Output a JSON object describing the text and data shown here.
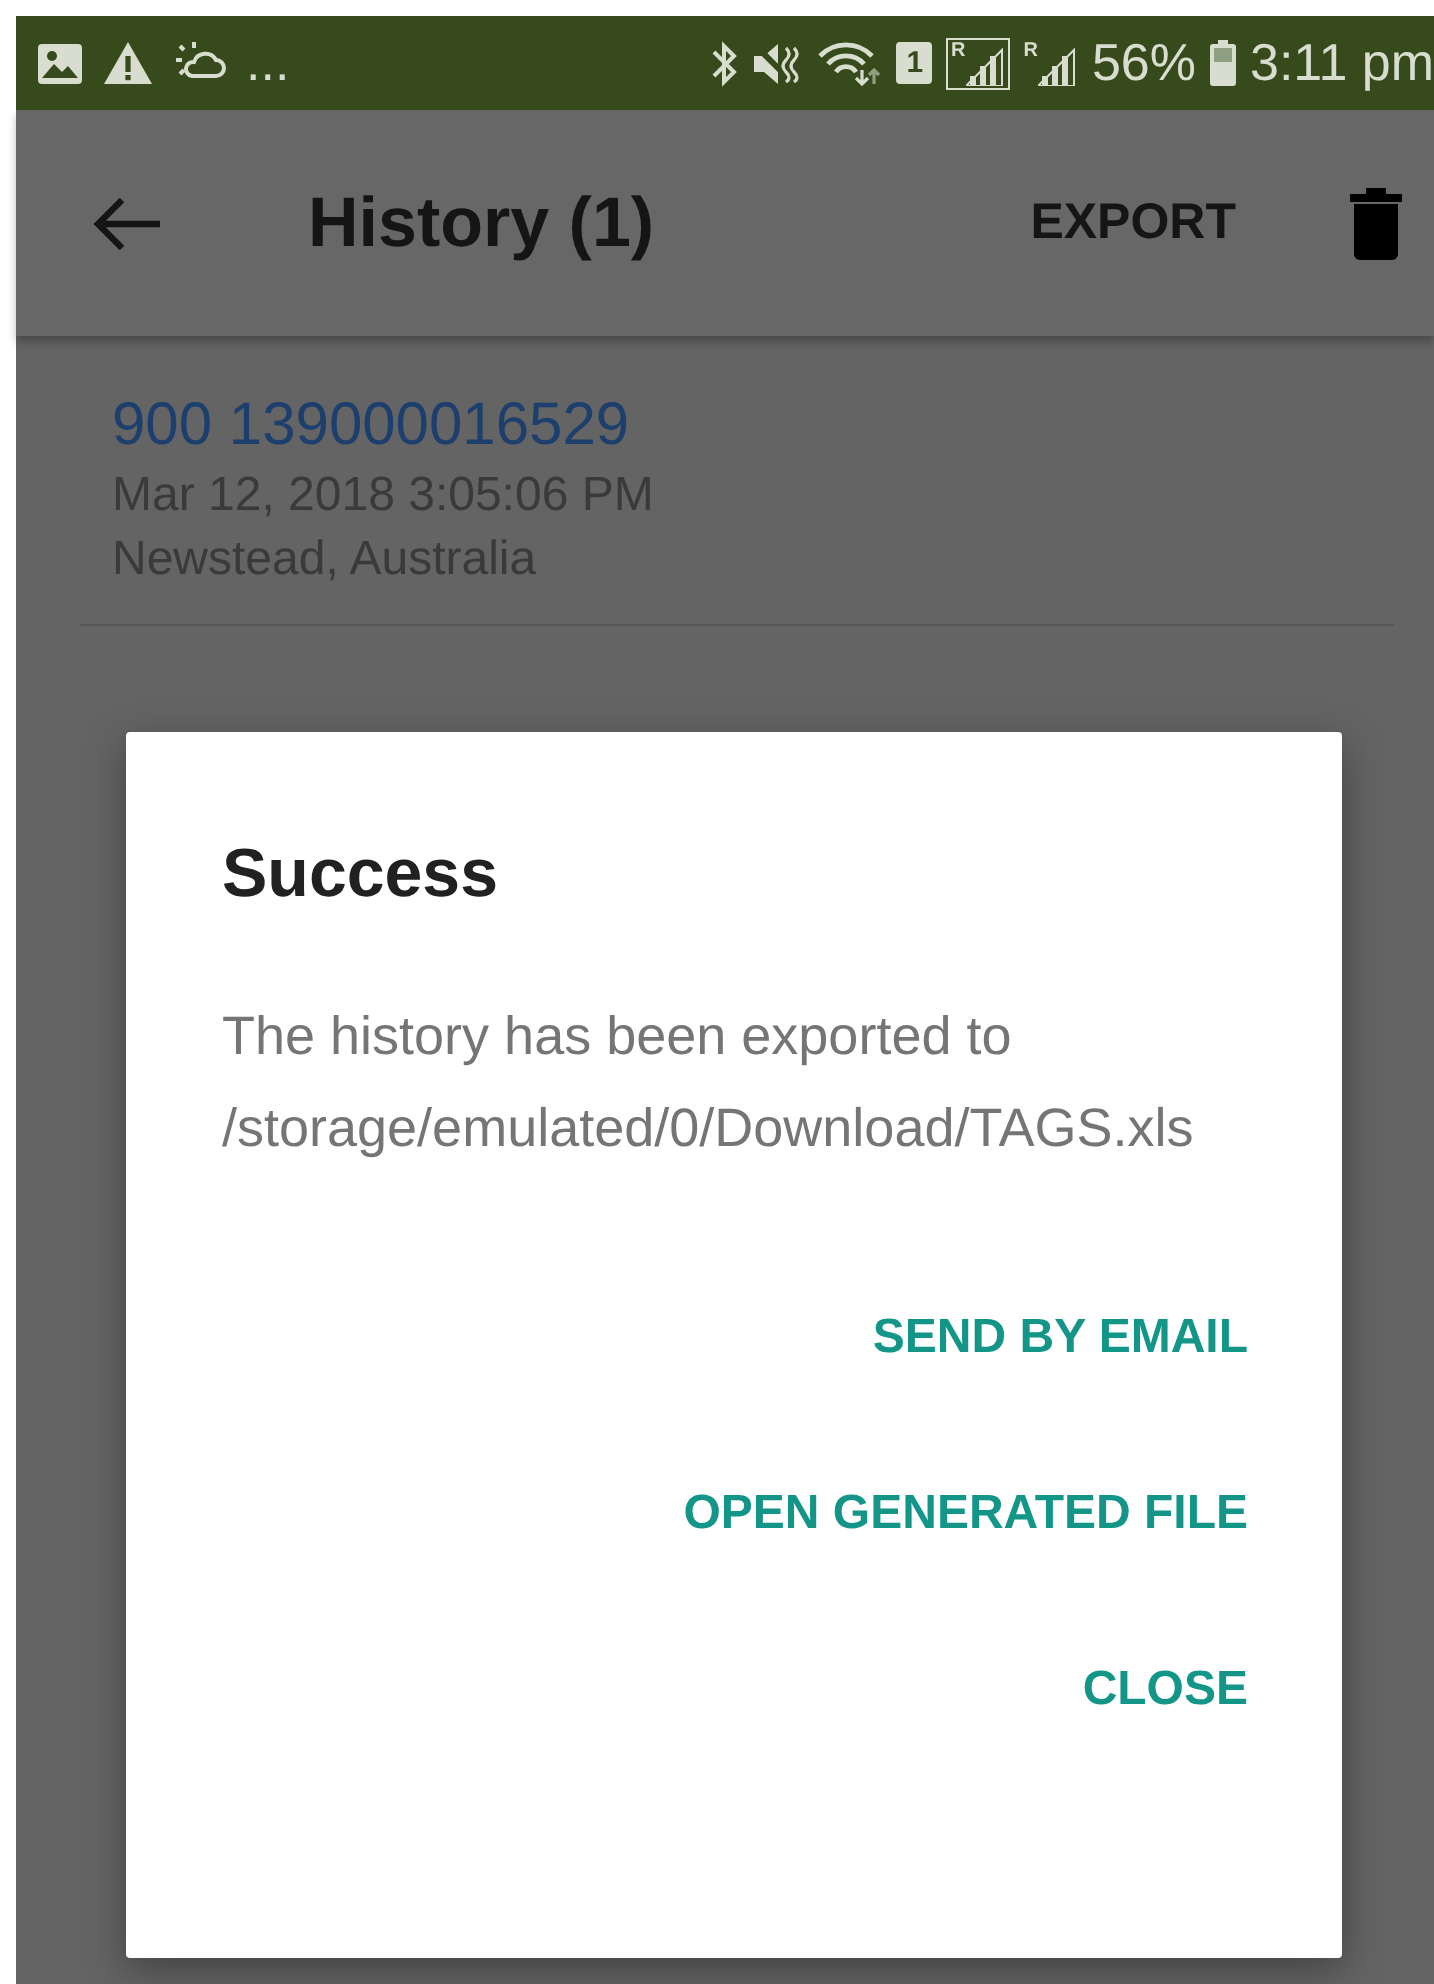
{
  "status_bar": {
    "overflow": "...",
    "sim_slot": "1",
    "signals": [
      {
        "roaming": "R"
      },
      {
        "roaming": "R"
      }
    ],
    "battery": "56%",
    "time": "3:11 pm"
  },
  "app_bar": {
    "title": "History (1)",
    "action": "EXPORT"
  },
  "history": [
    {
      "code": "900 139000016529",
      "date": "Mar 12, 2018 3:05:06 PM",
      "place": "Newstead, Australia"
    }
  ],
  "dialog": {
    "title": "Success",
    "message": "The history has been exported to /storage/emulated/0/Download/TAGS.xls",
    "buttons": [
      "SEND BY EMAIL",
      "OPEN GENERATED FILE",
      "CLOSE"
    ]
  }
}
